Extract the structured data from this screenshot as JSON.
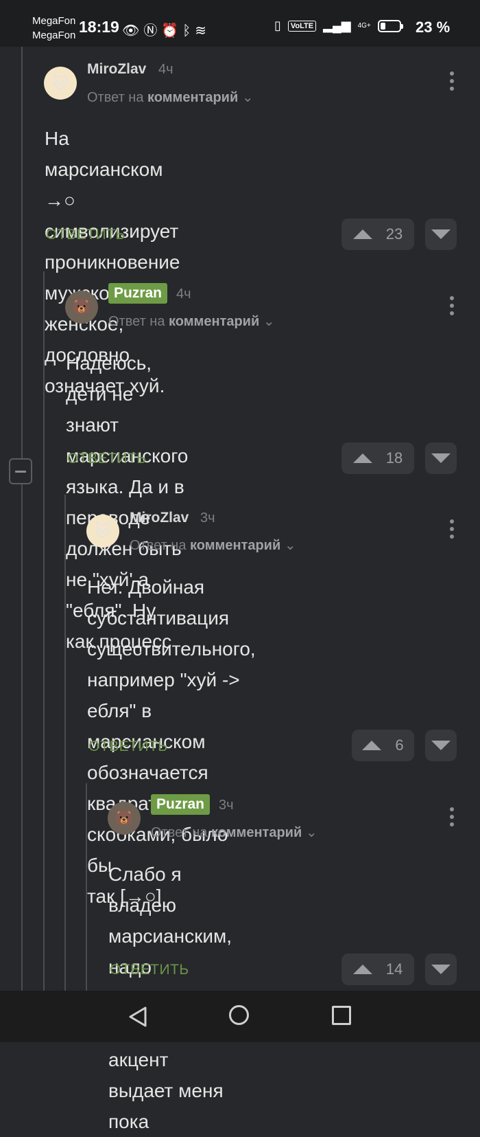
{
  "status_bar": {
    "carrier_1": "MegaFon",
    "carrier_2": "MegaFon",
    "time": "18:19",
    "volte": "VoLTE",
    "network": "4G+",
    "battery": "23 %"
  },
  "colors": {
    "background": "#26282b",
    "accent_green": "#6c9448",
    "badge_green": "#6e9b45"
  },
  "comments": [
    {
      "author": "MiroZlav",
      "time": "4ч",
      "reply_prefix": "Ответ на",
      "reply_target": "комментарий",
      "text_lines": [
        "На марсианском →○ символизирует",
        "проникновение мужского в женское,",
        "дословно означает хуй."
      ],
      "reply_label": "ОТВЕТИТЬ",
      "votes": "23"
    },
    {
      "author": "Puzran",
      "time": "4ч",
      "reply_prefix": "Ответ на",
      "reply_target": "комментарий",
      "text_lines": [
        "Надеюсь, дети не знают марсианского",
        "языка. Да и в переводе должен быть",
        "не \"хуй' а \"ебля\". Ну как процесс"
      ],
      "reply_label": "ОТВЕТИТЬ",
      "votes": "18"
    },
    {
      "author": "MiroZlav",
      "time": "3ч",
      "reply_prefix": "Ответ на",
      "reply_target": "комментарий",
      "text_lines": [
        "Нет. Двойная субстантивация",
        "существительного, например \"хуй ->",
        "ебля\" в марсианском обозначается",
        "квадратными скобками, было бы",
        "так [→○]"
      ],
      "reply_label": "ОТВЕТИТЬ",
      "votes": "6"
    },
    {
      "author": "Puzran",
      "time": "3ч",
      "reply_prefix": "Ответ на",
      "reply_target": "комментарий",
      "text_lines": [
        "Слабо я владею марсианским,",
        "надо признать. Да и русский",
        "акцент выдает меня пока"
      ],
      "reply_label": "ОТВЕТИТЬ",
      "votes": "14"
    }
  ]
}
